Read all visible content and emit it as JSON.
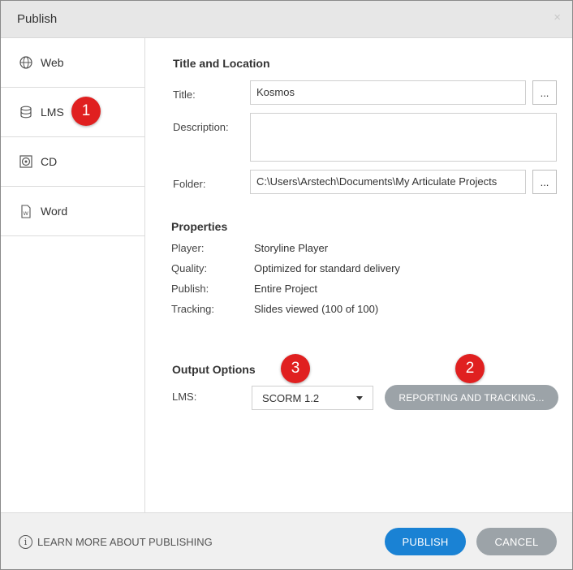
{
  "window": {
    "title": "Publish",
    "close_glyph": "×"
  },
  "sidebar": {
    "items": [
      {
        "label": "Web",
        "icon": "globe-icon"
      },
      {
        "label": "LMS",
        "icon": "database-icon"
      },
      {
        "label": "CD",
        "icon": "disc-icon"
      },
      {
        "label": "Word",
        "icon": "word-doc-icon"
      }
    ]
  },
  "badges": {
    "one": "1",
    "two": "2",
    "three": "3",
    "color": "#e02020"
  },
  "title_location": {
    "heading": "Title and Location",
    "title_label": "Title:",
    "title_value": "Kosmos",
    "description_label": "Description:",
    "description_value": "",
    "folder_label": "Folder:",
    "folder_value": "C:\\Users\\Arstech\\Documents\\My Articulate Projects",
    "browse_label": "..."
  },
  "properties": {
    "heading": "Properties",
    "rows": [
      {
        "label": "Player:",
        "value": "Storyline Player"
      },
      {
        "label": "Quality:",
        "value": "Optimized for standard delivery"
      },
      {
        "label": "Publish:",
        "value": "Entire Project"
      },
      {
        "label": "Tracking:",
        "value": "Slides viewed (100 of 100)"
      }
    ]
  },
  "output": {
    "heading": "Output Options",
    "lms_label": "LMS:",
    "lms_selected": "SCORM 1.2",
    "reporting_button": "REPORTING AND TRACKING..."
  },
  "footer": {
    "learn_more": "LEARN MORE ABOUT PUBLISHING",
    "publish_button": "PUBLISH",
    "cancel_button": "CANCEL"
  },
  "colors": {
    "accent_blue": "#1a82d4",
    "gray_button": "#9ca3a8",
    "titlebar": "#e7e7e7",
    "footer": "#f0f0f0"
  }
}
